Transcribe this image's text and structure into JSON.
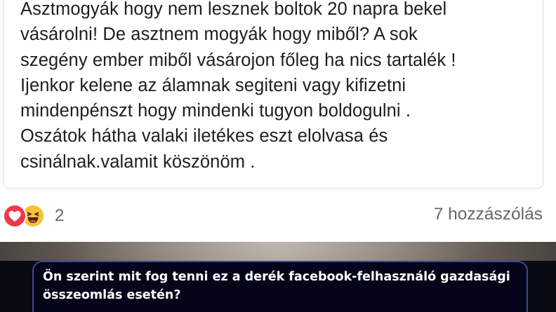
{
  "post": {
    "text": "Asztmogyák hogy nem lesznek boltok 20 napra bekel\nvásárolni! De asztnem mogyák hogy miből? A sok\nszegény ember miből vásárojon főleg ha nics tartalék !\nIjenkor kelene az álamnak segiteni vagy kifizetni\nmindenpénszt hogy mindenki tugyon boldogulni .\nOszátok hátha valaki iletékes eszt elolvasa és\ncsinálnak.valamit köszönöm ."
  },
  "reactions": {
    "icons": [
      "love-reaction-icon",
      "haha-reaction-icon"
    ],
    "count": "2",
    "colors": {
      "love": "#f0374b",
      "haha": "#f7c234"
    }
  },
  "comments": {
    "label": "7 hozzászólás"
  },
  "quiz": {
    "question": "Ön szerint mit fog tenni ez a derék facebook-felhasználó gazdasági összeomlás esetén?"
  }
}
